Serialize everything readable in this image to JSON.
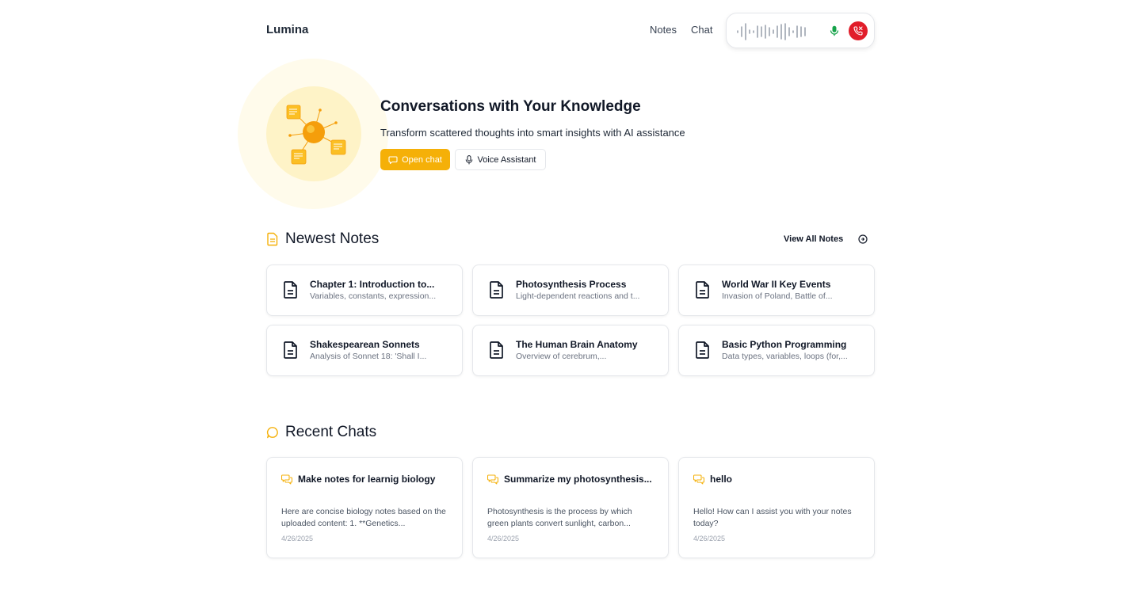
{
  "app": {
    "name": "Lumina"
  },
  "nav": {
    "items": [
      "Notes",
      "Chat"
    ]
  },
  "voice": {
    "status_icon": "mic-icon",
    "end_icon": "phone-off-icon",
    "end_color": "#e11d2a",
    "mic_color": "#16a34a"
  },
  "hero": {
    "title": "Conversations with Your Knowledge",
    "subtitle": "Transform scattered thoughts into smart insights with AI assistance",
    "open_chat_label": "Open chat",
    "voice_assistant_label": "Voice Assistant"
  },
  "notes_section": {
    "title": "Newest Notes",
    "view_all_label": "View All Notes",
    "notes": [
      {
        "title": "Chapter 1: Introduction to...",
        "description": "Variables, constants, expression..."
      },
      {
        "title": "Photosynthesis Process",
        "description": "Light-dependent reactions and t..."
      },
      {
        "title": "World War II Key Events",
        "description": "Invasion of Poland, Battle of..."
      },
      {
        "title": "Shakespearean Sonnets",
        "description": "Analysis of Sonnet 18: 'Shall I..."
      },
      {
        "title": "The Human Brain Anatomy",
        "description": "Overview of cerebrum,..."
      },
      {
        "title": "Basic Python Programming",
        "description": "Data types, variables, loops (for,..."
      }
    ]
  },
  "chats_section": {
    "title": "Recent Chats",
    "chats": [
      {
        "title": "Make notes for learnig biology",
        "preview": "Here are concise biology notes based on the uploaded content: 1. **Genetics...",
        "date": "4/26/2025"
      },
      {
        "title": "Summarize my photosynthesis...",
        "preview": "Photosynthesis is the process by which green plants convert sunlight, carbon...",
        "date": "4/26/2025"
      },
      {
        "title": "hello",
        "preview": "Hello! How can I assist you with your notes today?",
        "date": "4/26/2025"
      }
    ]
  },
  "colors": {
    "accent": "#f5b008",
    "accent_light": "#fef3c7"
  }
}
